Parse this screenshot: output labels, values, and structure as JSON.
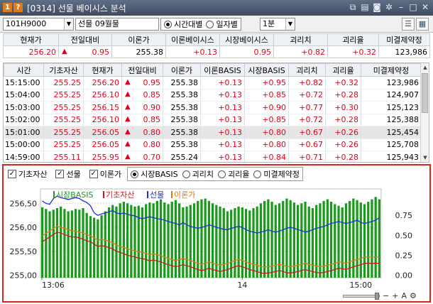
{
  "window": {
    "title": "[0314] 선물 베이시스 분석",
    "badge_num": "1",
    "badge_help": "?"
  },
  "toolbar": {
    "code": "101H9000",
    "name": "선물 09월물",
    "view_modes": [
      {
        "label": "시간대별",
        "selected": true
      },
      {
        "label": "일자별",
        "selected": false
      }
    ],
    "interval": "1분"
  },
  "summary": {
    "headers": [
      "현재가",
      "전일대비",
      "이론가",
      "이론베이시스",
      "시장베이시스",
      "괴리치",
      "괴리율",
      "미결제약정"
    ],
    "values": {
      "price": "256.20",
      "change_arrow": "▲",
      "change": "0.95",
      "theory_price": "255.38",
      "theory_basis": "+0.13",
      "market_basis": "0.95",
      "gap": "+0.82",
      "gap_rate": "+0.32",
      "open_interest": "123,986"
    }
  },
  "detail": {
    "headers": [
      "시간",
      "기초자산",
      "현재가",
      "전일대비",
      "이론가",
      "이론BASIS",
      "시장BASIS",
      "괴리치",
      "괴리율",
      "미결제약정"
    ],
    "rows": [
      [
        "15:15:00",
        "255.25",
        "256.20",
        "▲",
        "0.95",
        "255.38",
        "+0.13",
        "+0.95",
        "+0.82",
        "+0.32",
        "123,986"
      ],
      [
        "15:04:00",
        "255.25",
        "256.10",
        "▲",
        "0.85",
        "255.38",
        "+0.13",
        "+0.85",
        "+0.72",
        "+0.28",
        "124,907"
      ],
      [
        "15:03:00",
        "255.25",
        "256.15",
        "▲",
        "0.90",
        "255.38",
        "+0.13",
        "+0.90",
        "+0.77",
        "+0.30",
        "125,123"
      ],
      [
        "15:02:00",
        "255.25",
        "256.10",
        "▲",
        "0.85",
        "255.38",
        "+0.13",
        "+0.85",
        "+0.72",
        "+0.28",
        "125,388"
      ],
      [
        "15:01:00",
        "255.25",
        "256.05",
        "▲",
        "0.80",
        "255.38",
        "+0.13",
        "+0.80",
        "+0.67",
        "+0.26",
        "125,454"
      ],
      [
        "15:00:00",
        "255.25",
        "256.05",
        "▲",
        "0.80",
        "255.38",
        "+0.13",
        "+0.80",
        "+0.67",
        "+0.26",
        "125,708"
      ],
      [
        "14:59:00",
        "255.11",
        "255.95",
        "▲",
        "0.70",
        "255.24",
        "+0.13",
        "+0.84",
        "+0.71",
        "+0.28",
        "125,943"
      ]
    ],
    "selected_row": 4
  },
  "chart_options": {
    "checkboxes": [
      {
        "label": "기초자산",
        "checked": true
      },
      {
        "label": "선물",
        "checked": true
      },
      {
        "label": "이론가",
        "checked": true
      }
    ],
    "modes": [
      {
        "label": "시장BASIS",
        "selected": true
      },
      {
        "label": "괴리치",
        "selected": false
      },
      {
        "label": "괴리율",
        "selected": false
      },
      {
        "label": "미결제약정",
        "selected": false
      }
    ]
  },
  "colors": {
    "red": "#e0001b",
    "basis_bar": "#1a9a1a",
    "futures_line": "#1f2fd6",
    "underlying_line": "#d01818",
    "theory_line": "#e07a10",
    "panel_border": "#d9261c"
  },
  "chart_data": {
    "type": "bar",
    "legend": [
      {
        "name": "시장BASIS",
        "color": "#1a9a1a"
      },
      {
        "name": "기초자산",
        "color": "#d01818"
      },
      {
        "name": "선물",
        "color": "#1f2fd6"
      },
      {
        "name": "이론가",
        "color": "#e07a10"
      }
    ],
    "x_ticks": [
      "13:06",
      "14",
      "15:00"
    ],
    "left_axis": {
      "ticks": [
        "256,50",
        "256,00",
        "255,50",
        "255,00"
      ],
      "ylim": [
        254.95,
        256.8
      ]
    },
    "right_axis": {
      "ticks": [
        "0.75",
        "0.50",
        "0.25",
        "0.00"
      ],
      "ylim": [
        -0.03,
        1.08
      ]
    },
    "series": [
      {
        "name": "시장BASIS",
        "axis": "right",
        "values": [
          0.85,
          0.83,
          0.8,
          0.82,
          0.84,
          0.86,
          0.83,
          0.8,
          0.81,
          0.83,
          0.82,
          0.84,
          0.78,
          0.74,
          0.72,
          0.7,
          0.75,
          0.8,
          0.85,
          0.88,
          0.86,
          0.9,
          0.92,
          0.9,
          0.88,
          0.86,
          0.87,
          0.85,
          0.89,
          0.91,
          0.9,
          0.93,
          0.95,
          0.91,
          0.89,
          0.92,
          0.94,
          0.9,
          0.85,
          0.86,
          0.88,
          0.9,
          0.93,
          0.95,
          0.96,
          0.93,
          0.9,
          0.88,
          0.86,
          0.84,
          0.8,
          0.82,
          0.84,
          0.86,
          0.85,
          0.83,
          0.81,
          0.84,
          0.86,
          0.9,
          0.93,
          0.95,
          0.92,
          0.88,
          0.9,
          0.93,
          0.96,
          0.94,
          0.91,
          0.88,
          0.9,
          0.92,
          0.86,
          0.84,
          0.88,
          0.9,
          0.93,
          0.95,
          0.92,
          0.89,
          0.87,
          0.85,
          0.9,
          0.93,
          0.96,
          0.94,
          0.91,
          0.89,
          0.92,
          0.95,
          0.98,
          0.95
        ]
      },
      {
        "name": "선물",
        "axis": "left",
        "values": [
          256.55,
          256.5,
          256.48,
          256.6,
          256.65,
          256.62,
          256.6,
          256.58,
          256.6,
          256.62,
          256.6,
          256.55,
          256.52,
          256.45,
          256.3,
          256.25,
          256.28,
          256.3,
          256.32,
          256.35,
          256.3,
          256.28,
          256.3,
          256.27,
          256.25,
          256.24,
          256.2,
          256.18,
          256.2,
          256.22,
          256.2,
          256.18,
          256.17,
          256.15,
          256.12,
          256.1,
          256.08,
          256.05,
          256.1,
          256.05,
          256.02,
          256.0,
          255.98,
          256.0,
          256.02,
          256.05,
          256.03,
          256.0,
          255.98,
          255.96,
          255.95,
          255.98,
          256.0,
          256.02,
          256.0,
          255.95,
          255.92,
          255.9,
          255.88,
          255.9,
          255.92,
          255.95,
          255.92,
          255.9,
          255.92,
          255.95,
          255.98,
          256.0,
          255.98,
          255.95,
          255.93,
          255.9,
          255.92,
          255.95,
          255.98,
          256.0,
          256.02,
          256.05,
          256.08,
          256.1,
          256.12,
          256.1,
          256.08,
          256.1,
          256.12,
          256.15,
          256.1,
          256.08,
          256.1,
          256.12,
          256.15,
          256.2
        ]
      },
      {
        "name": "기초자산",
        "axis": "left",
        "values": [
          255.7,
          255.75,
          255.8,
          255.85,
          255.9,
          255.88,
          255.85,
          255.82,
          255.8,
          255.8,
          255.78,
          255.75,
          255.72,
          255.7,
          255.65,
          255.6,
          255.62,
          255.6,
          255.58,
          255.55,
          255.5,
          255.48,
          255.45,
          255.42,
          255.4,
          255.38,
          255.36,
          255.35,
          255.33,
          255.3,
          255.32,
          255.3,
          255.28,
          255.25,
          255.22,
          255.2,
          255.18,
          255.2,
          255.22,
          255.2,
          255.18,
          255.15,
          255.12,
          255.1,
          255.12,
          255.15,
          255.12,
          255.1,
          255.08,
          255.1,
          255.12,
          255.15,
          255.18,
          255.2,
          255.18,
          255.15,
          255.12,
          255.1,
          255.08,
          255.05,
          255.04,
          255.05,
          255.06,
          255.08,
          255.1,
          255.08,
          255.05,
          255.05,
          255.06,
          255.08,
          255.1,
          255.12,
          255.1,
          255.08,
          255.06,
          255.05,
          255.06,
          255.08,
          255.1,
          255.12,
          255.15,
          255.14,
          255.12,
          255.15,
          255.18,
          255.2,
          255.22,
          255.25,
          255.25,
          255.25,
          255.25,
          255.25
        ]
      },
      {
        "name": "이론가",
        "axis": "left",
        "values": [
          255.82,
          255.88,
          255.92,
          255.98,
          256.02,
          256.0,
          255.98,
          255.95,
          255.93,
          255.92,
          255.9,
          255.88,
          255.85,
          255.82,
          255.78,
          255.73,
          255.75,
          255.73,
          255.71,
          255.68,
          255.63,
          255.6,
          255.58,
          255.55,
          255.53,
          255.51,
          255.49,
          255.48,
          255.46,
          255.43,
          255.45,
          255.43,
          255.41,
          255.38,
          255.35,
          255.33,
          255.31,
          255.33,
          255.35,
          255.33,
          255.31,
          255.28,
          255.25,
          255.23,
          255.25,
          255.28,
          255.25,
          255.23,
          255.21,
          255.23,
          255.25,
          255.28,
          255.31,
          255.33,
          255.31,
          255.28,
          255.25,
          255.23,
          255.21,
          255.18,
          255.17,
          255.18,
          255.19,
          255.21,
          255.23,
          255.21,
          255.18,
          255.18,
          255.19,
          255.21,
          255.23,
          255.25,
          255.23,
          255.21,
          255.19,
          255.18,
          255.19,
          255.21,
          255.23,
          255.25,
          255.28,
          255.27,
          255.25,
          255.28,
          255.31,
          255.33,
          255.35,
          255.38,
          255.38,
          255.38,
          255.38,
          255.38
        ]
      }
    ]
  }
}
